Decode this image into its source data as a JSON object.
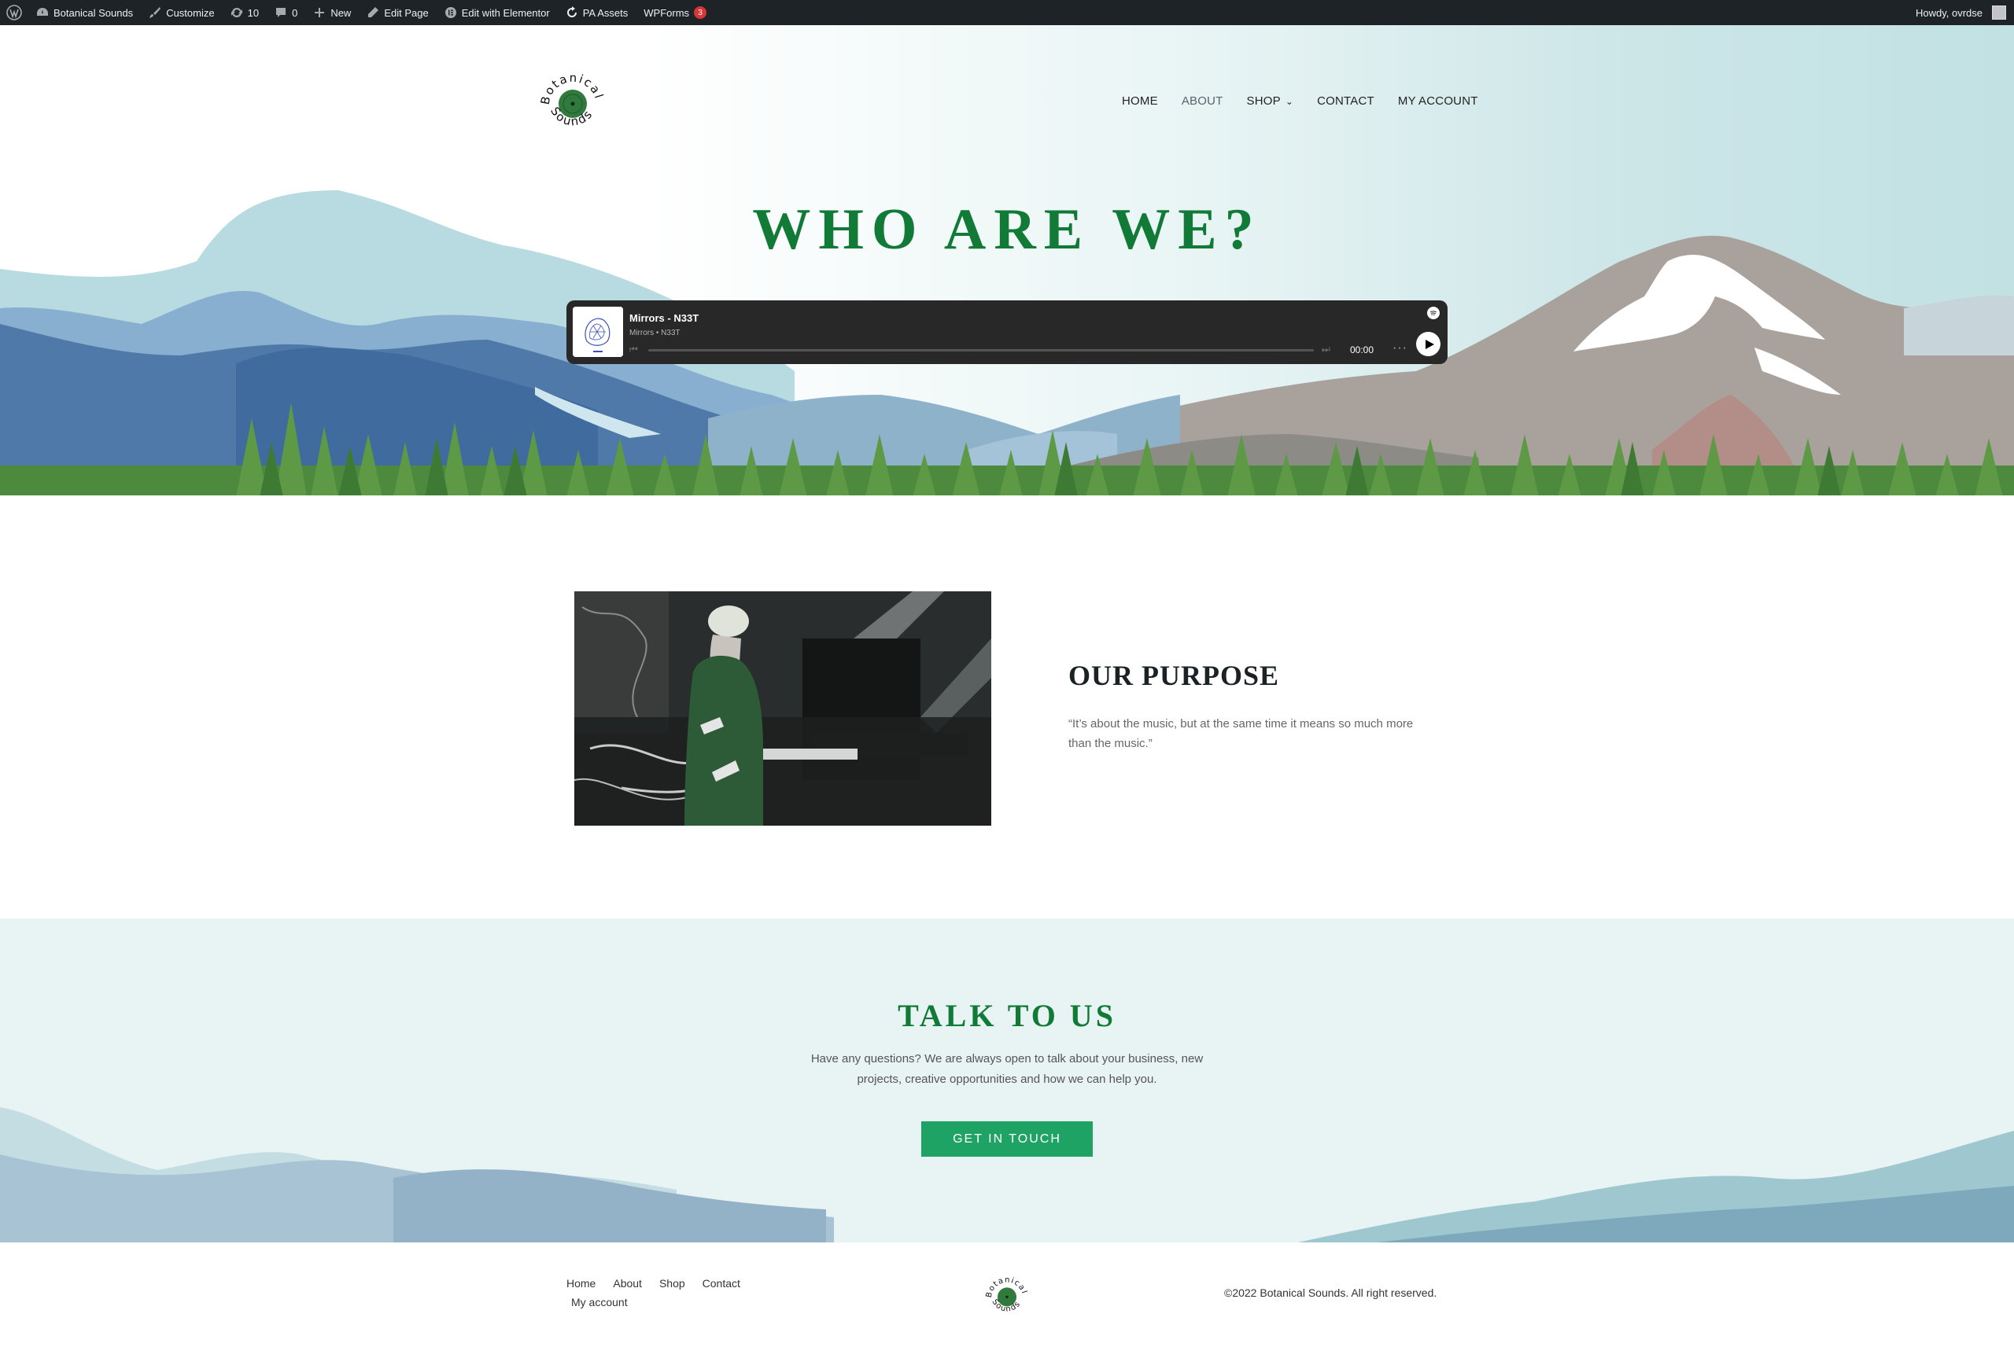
{
  "adminbar": {
    "site_name": "Botanical Sounds",
    "customize": "Customize",
    "updates_count": "10",
    "comments_count": "0",
    "new": "New",
    "edit_page": "Edit Page",
    "edit_elementor": "Edit with Elementor",
    "pa_assets": "PA Assets",
    "wpforms": "WPForms",
    "wpforms_badge": "3",
    "howdy": "Howdy, ovrdse"
  },
  "header": {
    "logo_text_top": "Botanical",
    "logo_text_bottom": "Sounds",
    "nav": [
      {
        "label": "HOME"
      },
      {
        "label": "ABOUT",
        "active": true
      },
      {
        "label": "SHOP",
        "has_dropdown": true
      },
      {
        "label": "CONTACT"
      },
      {
        "label": "MY ACCOUNT"
      }
    ]
  },
  "hero": {
    "title": "WHO ARE WE?"
  },
  "player": {
    "track_title": "Mirrors - N33T",
    "track_sub": "Mirrors • N33T",
    "time": "00:00",
    "more": "···"
  },
  "purpose": {
    "title": "OUR PURPOSE",
    "quote": "“It’s about the music, but at the same time it means so much more than the music.”"
  },
  "talk": {
    "title": "TALK TO US",
    "text": "Have any questions? We are always open to talk about your business, new projects, creative opportunities and how we can help you.",
    "button": "GET IN TOUCH"
  },
  "footer": {
    "links": [
      "Home",
      "About",
      "Shop",
      "Contact",
      "My account"
    ],
    "copyright": "©2022 Botanical Sounds. All right reserved."
  },
  "colors": {
    "brand_green": "#117a36",
    "button_green": "#1fa365",
    "adminbar_bg": "#1d2327",
    "player_bg": "#282828"
  }
}
